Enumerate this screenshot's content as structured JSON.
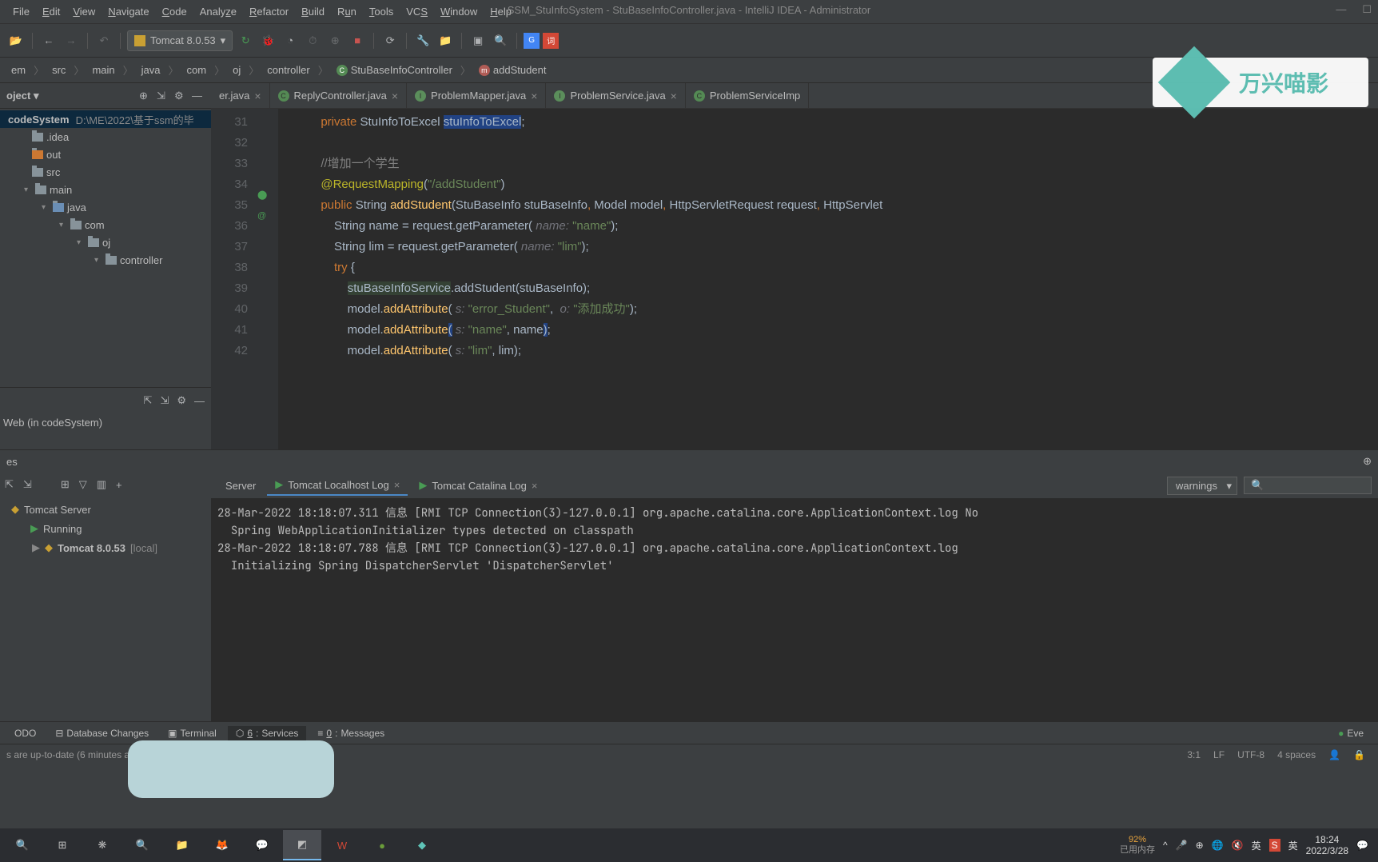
{
  "window": {
    "title": "SSM_StuInfoSystem - StuBaseInfoController.java - IntelliJ IDEA - Administrator"
  },
  "menu": {
    "file": "File",
    "edit": "Edit",
    "view": "View",
    "navigate": "Navigate",
    "code": "Code",
    "analyze": "Analyze",
    "refactor": "Refactor",
    "build": "Build",
    "run": "Run",
    "tools": "Tools",
    "vcs": "VCS",
    "window": "Window",
    "help": "Help"
  },
  "runConfig": {
    "label": "Tomcat 8.0.53"
  },
  "breadcrumb": {
    "items": [
      "em",
      "src",
      "main",
      "java",
      "com",
      "oj",
      "controller",
      "StuBaseInfoController",
      "addStudent"
    ]
  },
  "project": {
    "dropdown": "oject",
    "root": {
      "name": "codeSystem",
      "path": "D:\\ME\\2022\\基于ssm的毕"
    },
    "items": [
      {
        "name": ".idea",
        "indent": 18
      },
      {
        "name": "out",
        "indent": 18
      },
      {
        "name": "src",
        "indent": 18
      },
      {
        "name": "main",
        "indent": 40,
        "expanded": true
      },
      {
        "name": "java",
        "indent": 62,
        "expanded": true
      },
      {
        "name": "com",
        "indent": 84,
        "expanded": true
      },
      {
        "name": "oj",
        "indent": 106,
        "expanded": true
      },
      {
        "name": "controller",
        "indent": 128,
        "expanded": true
      }
    ],
    "web": "Web (in codeSystem)"
  },
  "editorTabs": [
    {
      "name": "er.java",
      "partial": true
    },
    {
      "name": "ReplyController.java"
    },
    {
      "name": "ProblemMapper.java"
    },
    {
      "name": "ProblemService.java"
    },
    {
      "name": "ProblemServiceImp"
    }
  ],
  "code": {
    "startLine": 31,
    "lines": [
      {
        "n": 31,
        "html": "        <span class='kw'>private</span> StuInfoToExcel <span class='hl'>stuInfoToExcel</span>;"
      },
      {
        "n": 32,
        "html": ""
      },
      {
        "n": 33,
        "html": "        <span class='cm'>//增加一个学生</span>"
      },
      {
        "n": 34,
        "html": "        <span class='ann'>@RequestMapping</span>(<span class='str'>\"/addStudent\"</span>)"
      },
      {
        "n": 35,
        "html": "        <span class='kw'>public</span> String <span class='fn'>addStudent</span>(StuBaseInfo stuBaseInfo<span class='kw'>,</span> Model model<span class='kw'>,</span> HttpServletRequest request<span class='kw'>,</span> HttpServlet"
      },
      {
        "n": 36,
        "html": "            String name = request.getParameter( <span class='param'>name:</span> <span class='str'>\"name\"</span>);"
      },
      {
        "n": 37,
        "html": "            String lim = request.getParameter( <span class='param'>name:</span> <span class='str'>\"lim\"</span>);"
      },
      {
        "n": 38,
        "html": "            <span class='kw'>try</span> {"
      },
      {
        "n": 39,
        "html": "                <span class='hl2'>stuBaseInfoService</span>.addStudent(stuBaseInfo);"
      },
      {
        "n": 40,
        "html": "                model.<span class='fn'>addAttribute</span>( <span class='param'>s:</span> <span class='str'>\"error_Student\"</span>,  <span class='param'>o:</span> <span class='str'>\"添加成功\"</span>);"
      },
      {
        "n": 41,
        "html": "                model.<span class='fn'>addAttribute</span><span class='hl'>(</span> <span class='param'>s:</span> <span class='str'>\"name\"</span>, name<span class='hl'>)</span>;"
      },
      {
        "n": 42,
        "html": "                model.<span class='fn'>addAttribute</span>( <span class='param'>s:</span> <span class='str'>\"lim\"</span>, lim);"
      }
    ]
  },
  "services": {
    "header": "es",
    "tree": {
      "root": "Tomcat Server",
      "running": "Running",
      "instance": "Tomcat 8.0.53",
      "local": "[local]"
    },
    "tabs": {
      "server": "Server",
      "localhost": "Tomcat Localhost Log",
      "catalina": "Tomcat Catalina Log"
    },
    "filter": {
      "level": "warnings"
    },
    "console": "28-Mar-2022 18:18:07.311 信息 [RMI TCP Connection(3)-127.0.0.1] org.apache.catalina.core.ApplicationContext.log No\n  Spring WebApplicationInitializer types detected on classpath\n28-Mar-2022 18:18:07.788 信息 [RMI TCP Connection(3)-127.0.0.1] org.apache.catalina.core.ApplicationContext.log\n  Initializing Spring DispatcherServlet 'DispatcherServlet'\n"
  },
  "bottomTabs": {
    "todo": "ODO",
    "db": "Database Changes",
    "terminal": "Terminal",
    "services": "Services",
    "messages": "Messages",
    "events": "Eve"
  },
  "statusbar": {
    "msg": "s are up-to-date (6 minutes ago)",
    "pos": "3:1",
    "le": "LF",
    "enc": "UTF-8",
    "indent": "4 spaces"
  },
  "taskbar": {
    "mem": {
      "pct": "92%",
      "label": "已用内存"
    },
    "ime1": "英",
    "ime2": "英",
    "time": "18:24",
    "date": "2022/3/28"
  },
  "watermark": {
    "text": "万兴喵影"
  }
}
